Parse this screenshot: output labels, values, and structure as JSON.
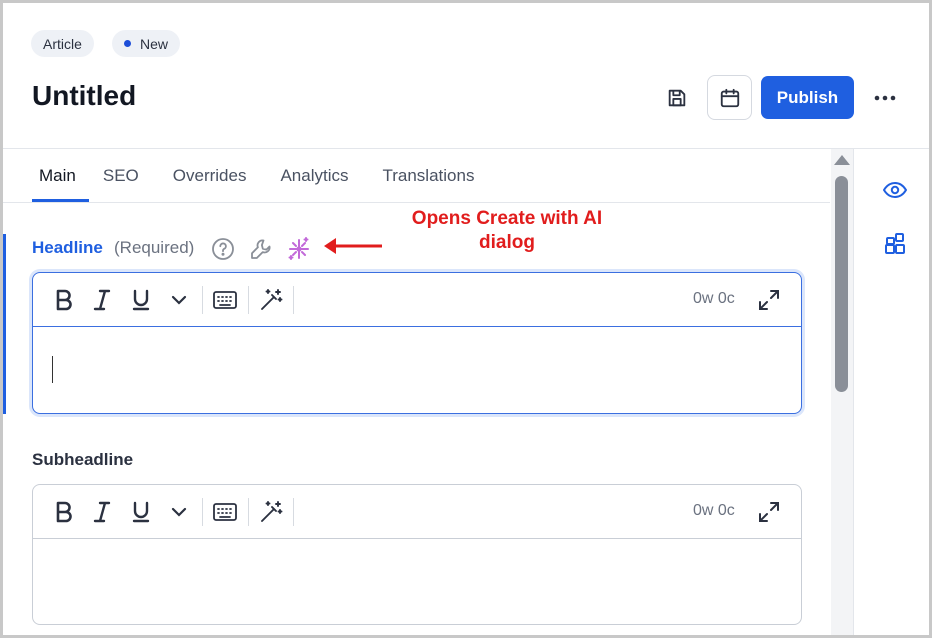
{
  "header": {
    "type_chip": "Article",
    "status_chip": "New",
    "title": "Untitled",
    "publish_label": "Publish"
  },
  "tabs": [
    {
      "label": "Main",
      "active": true
    },
    {
      "label": "SEO",
      "active": false
    },
    {
      "label": "Overrides",
      "active": false
    },
    {
      "label": "Analytics",
      "active": false
    },
    {
      "label": "Translations",
      "active": false
    }
  ],
  "fields": {
    "headline": {
      "label": "Headline",
      "required_text": "(Required)",
      "count": "0w 0c"
    },
    "subheadline": {
      "label": "Subheadline",
      "count": "0w 0c"
    }
  },
  "annotation": {
    "line1": "Opens Create with AI",
    "line2": "dialog"
  },
  "colors": {
    "accent": "#1f5fe0",
    "annotation": "#e11d1d",
    "ai_icon": "#c26ad9"
  },
  "icons": [
    "save-icon",
    "calendar-icon",
    "more-icon",
    "help-icon",
    "wrench-icon",
    "ai-sparkle-icon",
    "eye-icon",
    "widgets-icon",
    "bold-icon",
    "italic-icon",
    "underline-icon",
    "chevron-down-icon",
    "keyboard-icon",
    "magic-wand-icon",
    "expand-icon"
  ]
}
